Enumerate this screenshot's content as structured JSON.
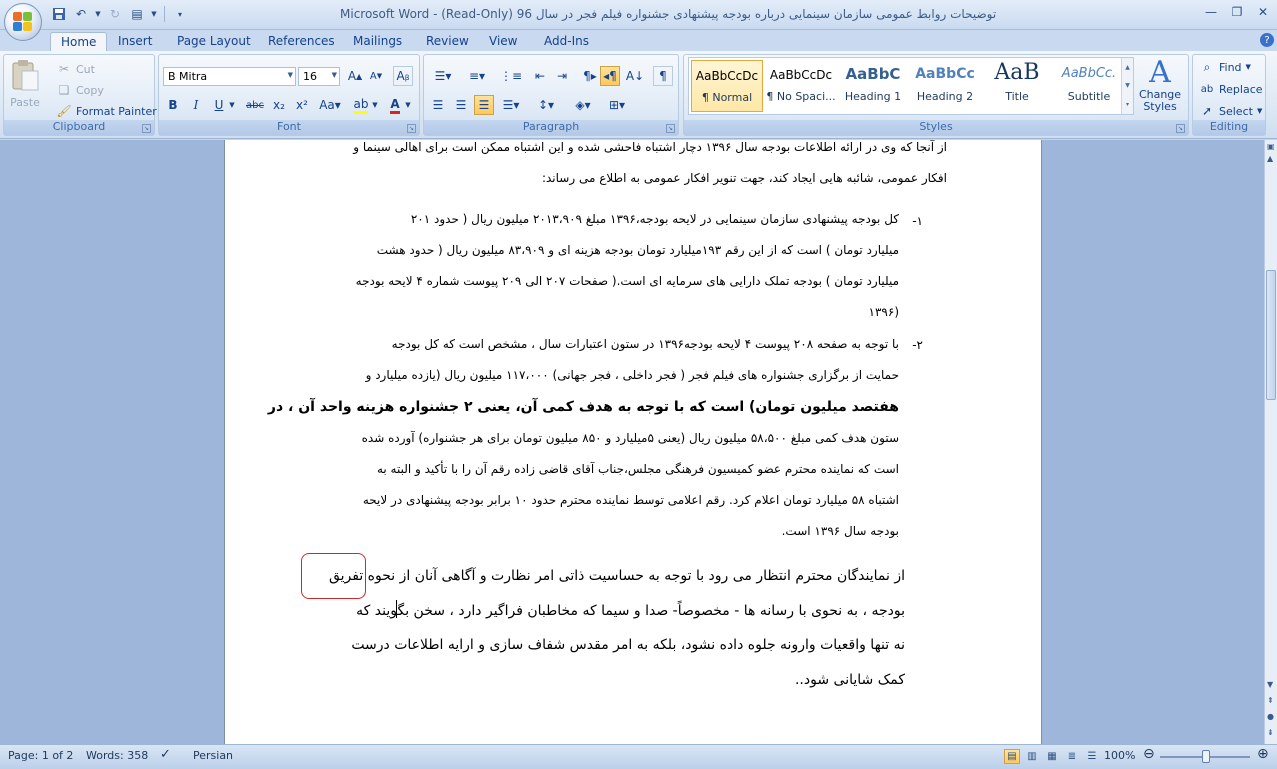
{
  "window": {
    "title": "توضیحات روابط عمومی سازمان سینمایی درباره بودجه پیشنهادی جشنواره فیلم فجر در سال 96 (Read-Only) - Microsoft Word"
  },
  "tabs": [
    "Home",
    "Insert",
    "Page Layout",
    "References",
    "Mailings",
    "Review",
    "View",
    "Add-Ins"
  ],
  "ribbon": {
    "clipboard": {
      "label": "Clipboard",
      "paste": "Paste",
      "cut": "Cut",
      "copy": "Copy",
      "format_painter": "Format Painter"
    },
    "font": {
      "label": "Font",
      "font_name": "B Mitra",
      "font_size": "16"
    },
    "paragraph": {
      "label": "Paragraph"
    },
    "styles": {
      "label": "Styles",
      "items": [
        {
          "sample": "AaBbCcDc",
          "name": "¶ Normal"
        },
        {
          "sample": "AaBbCcDc",
          "name": "¶ No Spaci..."
        },
        {
          "sample": "AaBbC",
          "name": "Heading 1"
        },
        {
          "sample": "AaBbCc",
          "name": "Heading 2"
        },
        {
          "sample": "AaB",
          "name": "Title"
        },
        {
          "sample": "AaBbCc.",
          "name": "Subtitle"
        }
      ],
      "change_styles": "Change Styles"
    },
    "editing": {
      "label": "Editing",
      "find": "Find",
      "replace": "Replace",
      "select": "Select"
    }
  },
  "document": {
    "top_lines": [
      "از آنجا که وی در ارائه اطلاعات بودجه سال ۱۳۹۶ دچار اشتباه فاحشی شده و این اشتباه ممکن است برای اهالی سینما و",
      "افکار عمومی، شائبه هایی ایجاد کند، جهت تنویر افکار عمومی به اطلاع می رساند:"
    ],
    "item1": {
      "number": "-۱",
      "lines": [
        "کل بودجه پیشنهادی سازمان سینمایی در لایحه بودجه،۱۳۹۶ مبلغ ۲۰۱۳،۹۰۹ میلیون ریال ( حدود ۲۰۱",
        "میلیارد تومان ) است که از این رقم ۱۹۳میلیارد تومان بودجه هزینه ای و ۸۳،۹۰۹ میلیون ریال ( حدود هشت",
        "میلیارد تومان ) بودجه تملک دارایی های سرمایه ای است.( صفحات ۲۰۷ الی ۲۰۹ پیوست شماره ۴ لایحه بودجه",
        "۱۳۹۶)"
      ]
    },
    "item2": {
      "number": "-۲",
      "lines": [
        "با توجه به صفحه ۲۰۸ پیوست ۴ لایحه بودجه۱۳۹۶ در ستون اعتبارات سال ، مشخص است که کل بودجه",
        "حمایت از برگزاری جشنواره های فیلم فجر ( فجر داخلی ، فجر جهانی) ۱۱۷،۰۰۰ میلیون ریال (یازده میلیارد و",
        "هفتصد میلیون تومان) است که با توجه به هدف کمی آن، یعنی ۲ جشنواره هزینه واحد آن ، در",
        "ستون هدف کمی مبلغ ۵۸،۵۰۰ میلیون ریال (یعنی ۵میلیارد و ۸۵۰ میلیون تومان برای هر جشنواره) آورده شده",
        "است که نماینده محترم عضو کمیسیون فرهنگی مجلس،جناب آقای قاضی زاده رقم آن را با تأکید و البته به",
        "اشتباه ۵۸ میلیارد تومان اعلام کرد. رقم اعلامی توسط نماینده محترم حدود ۱۰ برابر بودجه پیشنهادی در لایحه",
        "بودجه سال ۱۳۹۶ است."
      ]
    },
    "closing_lines": [
      "از نمایندگان محترم انتظار می رود با توجه به حساسیت ذاتی امر نظارت و آگاهی آنان از نحوه تفریق",
      "بودجه ، به نحوی با رسانه ها - مخصوصاً- صدا و سیما که مخاطبان فراگیر دارد ، سخن بگویند که",
      "نه تنها واقعیات وارونه جلوه داده نشود، بلکه به امر مقدس شفاف سازی و ارایه اطلاعات درست",
      "کمک شایانی شود.."
    ]
  },
  "statusbar": {
    "page": "Page: 1 of 2",
    "words": "Words: 358",
    "language": "Persian",
    "zoom": "100%"
  }
}
